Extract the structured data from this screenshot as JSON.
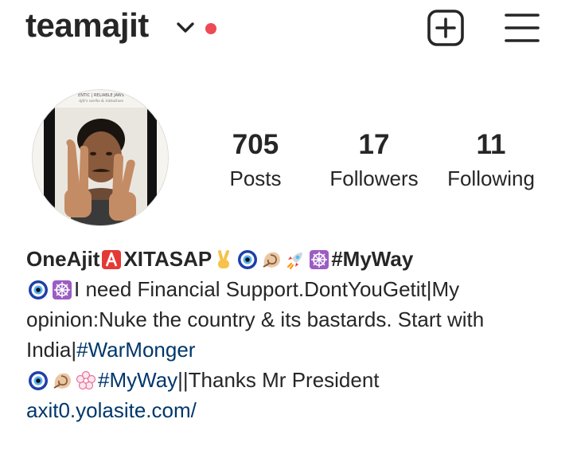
{
  "header": {
    "username": "teamajit"
  },
  "stats": [
    {
      "value": "705",
      "label": "Posts"
    },
    {
      "value": "17",
      "label": "Followers"
    },
    {
      "value": "11",
      "label": "Following"
    }
  ],
  "bio": {
    "name_part1": "OneAjit",
    "name_part2": "XITASAP",
    "hashtag_myway": "#MyWay",
    "line2_text": "I need Financial Support.DontYouGetit|My opinion:Nuke the country & its bastards. Start with India|",
    "hashtag_warmonger": "#WarMonger",
    "hashtag_myway2": "#MyWay",
    "line3_text": "||Thanks Mr President",
    "website": "axit0.yolasite.com/"
  },
  "avatar_text": {
    "banner": "ENTIC | RELIABLE JAWS",
    "subtitle": "Ajit's works & initiatives"
  },
  "colors": {
    "text": "#262626",
    "link": "#00376b",
    "online_dot": "#ed4956"
  },
  "icons": [
    "chevron-down-icon",
    "new-post-icon",
    "menu-icon",
    "a-button-emoji",
    "victory-hand-emoji",
    "nazar-amulet-emoji",
    "spiral-shell-emoji",
    "rocket-emoji",
    "wheel-of-dharma-emoji",
    "white-flower-emoji"
  ]
}
